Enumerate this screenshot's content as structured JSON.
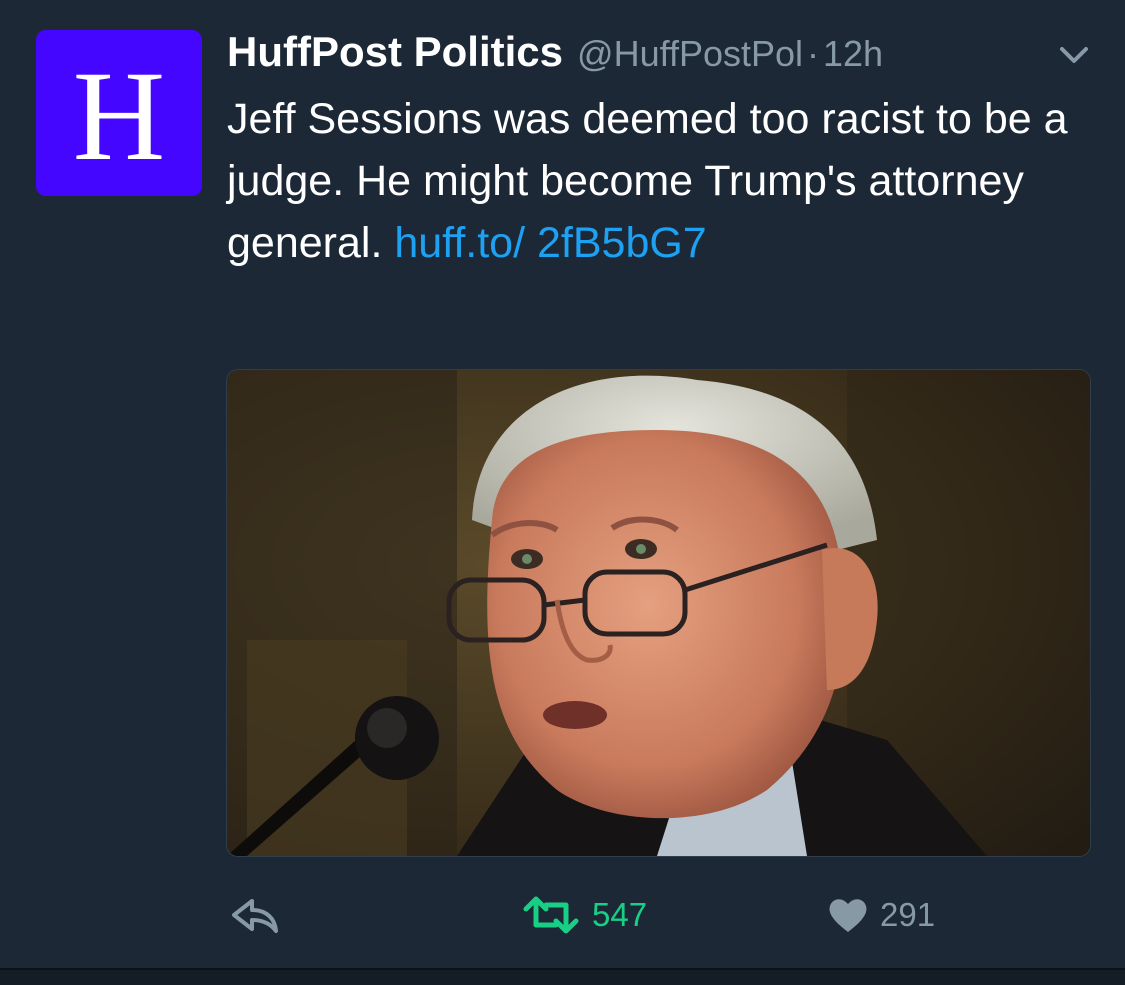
{
  "tweet": {
    "avatar": {
      "letter": "H",
      "bg_color": "#4406ff"
    },
    "display_name": "HuffPost Politics",
    "handle": "@HuffPostPol",
    "separator": "·",
    "timestamp": "12h",
    "text_main": "Jeff Sessions was deemed too racist to be a judge. He might become Trump's attorney general. ",
    "link_text": "huff.to/ 2fB5bG7",
    "link_color": "#1da1f2",
    "media": {
      "type": "photo",
      "subject": "man with glasses speaking at microphone"
    },
    "actions": {
      "reply": {
        "icon": "reply-icon"
      },
      "retweet": {
        "icon": "retweet-icon",
        "count": "547",
        "color": "#19cf86"
      },
      "like": {
        "icon": "heart-icon",
        "count": "291"
      }
    }
  },
  "colors": {
    "background": "#1c2836",
    "muted_text": "#8899a6"
  }
}
